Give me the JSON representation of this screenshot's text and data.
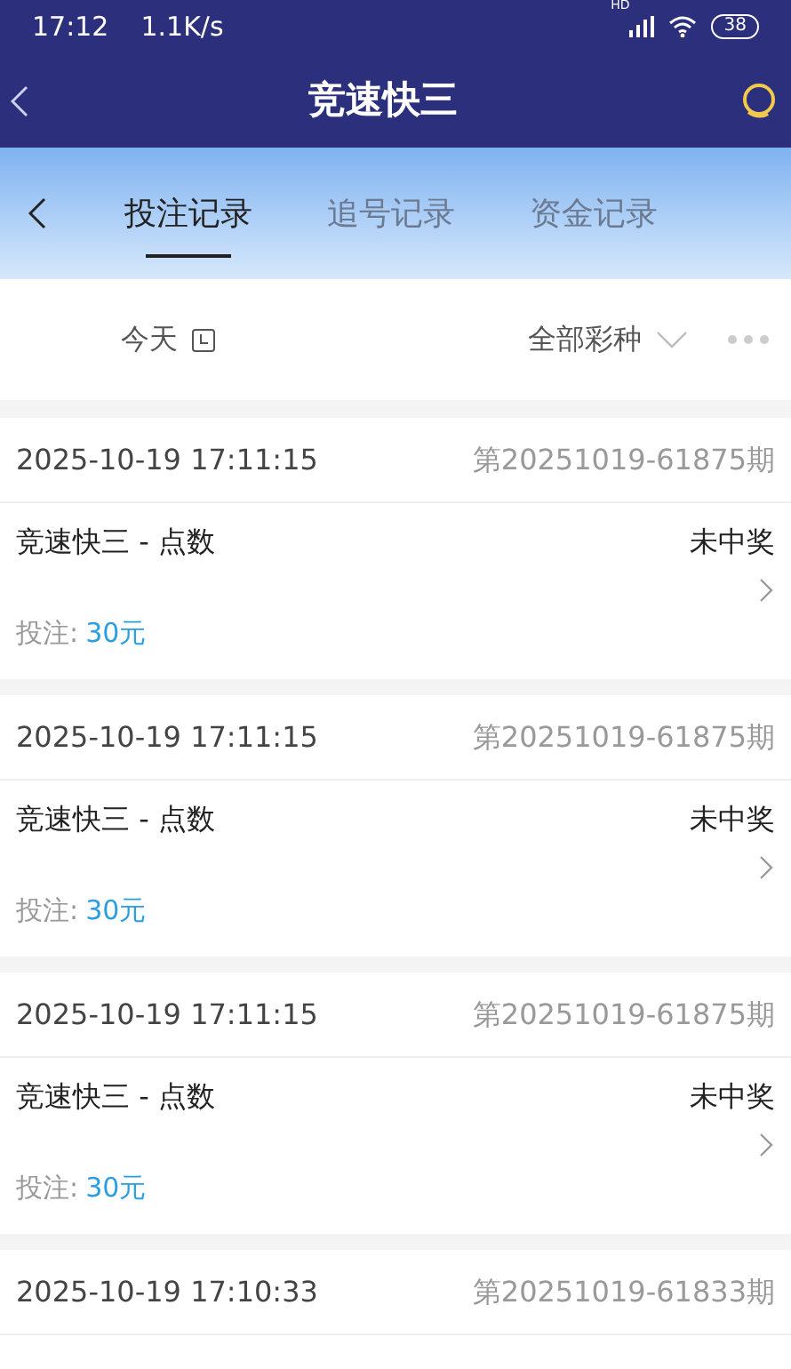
{
  "status_bar": {
    "time": "17:12",
    "speed": "1.1K/s",
    "network": "HD",
    "battery": "38"
  },
  "header": {
    "title": "竞速快三"
  },
  "tabs": [
    {
      "label": "投注记录",
      "selected": true
    },
    {
      "label": "追号记录",
      "selected": false
    },
    {
      "label": "资金记录",
      "selected": false
    }
  ],
  "filters": {
    "date": "今天",
    "lottery": "全部彩种"
  },
  "records": [
    {
      "time": "2025-10-19 17:11:15",
      "issue": "第20251019-61875期",
      "game": "竞速快三 - 点数",
      "result": "未中奖",
      "won": false,
      "bet_label": "投注:",
      "bet_amount": "30元"
    },
    {
      "time": "2025-10-19 17:11:15",
      "issue": "第20251019-61875期",
      "game": "竞速快三 - 点数",
      "result": "未中奖",
      "won": false,
      "bet_label": "投注:",
      "bet_amount": "30元"
    },
    {
      "time": "2025-10-19 17:11:15",
      "issue": "第20251019-61875期",
      "game": "竞速快三 - 点数",
      "result": "未中奖",
      "won": false,
      "bet_label": "投注:",
      "bet_amount": "30元"
    },
    {
      "time": "2025-10-19 17:10:33",
      "issue": "第20251019-61833期"
    }
  ]
}
